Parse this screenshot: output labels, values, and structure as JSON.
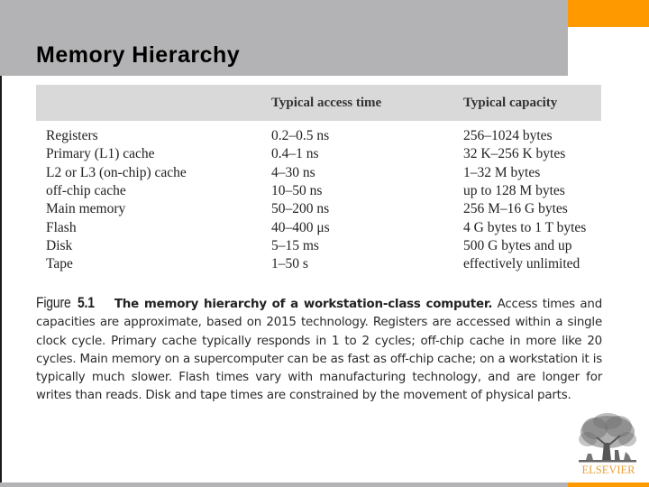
{
  "slide": {
    "title": "Memory Hierarchy"
  },
  "table": {
    "headers": [
      "",
      "Typical access time",
      "Typical capacity"
    ],
    "rows": [
      {
        "level": "Registers",
        "access_time": "0.2–0.5 ns",
        "capacity": "256–1024 bytes"
      },
      {
        "level": "Primary (L1) cache",
        "access_time": "0.4–1 ns",
        "capacity": "32 K–256 K bytes"
      },
      {
        "level": "L2 or L3 (on-chip) cache",
        "access_time": "4–30 ns",
        "capacity": "1–32 M bytes"
      },
      {
        "level": "off-chip cache",
        "access_time": "10–50 ns",
        "capacity": "up to 128 M bytes"
      },
      {
        "level": "Main memory",
        "access_time": "50–200 ns",
        "capacity": "256 M–16 G bytes"
      },
      {
        "level": "Flash",
        "access_time": "40–400 μs",
        "capacity": "4 G bytes to 1 T bytes"
      },
      {
        "level": "Disk",
        "access_time": "5–15 ms",
        "capacity": "500 G bytes and up"
      },
      {
        "level": "Tape",
        "access_time": "1–50 s",
        "capacity": "effectively unlimited"
      }
    ]
  },
  "caption": {
    "figure_word": "Figure",
    "figure_number": "5.1",
    "title": "The memory hierarchy of a workstation-class computer.",
    "body": "Access times and capacities are approximate, based on 2015 technology. Registers are accessed within a single clock cycle. Primary cache typically responds in 1 to 2 cycles; off-chip cache in more like 20 cycles. Main memory on a supercomputer can be as fast as off-chip cache; on a workstation it is typically much slower. Flash times vary with manufacturing technology, and are longer for writes than reads. Disk and tape times are constrained by the movement of physical parts."
  },
  "publisher": {
    "logo_icon": "elsevier-tree-icon",
    "name": "ELSEVIER"
  },
  "colors": {
    "title_bar": "#b3b3b5",
    "accent_orange": "#ff9900",
    "table_header_bg": "#d9d9d9",
    "logo_text": "#e8a13a"
  }
}
